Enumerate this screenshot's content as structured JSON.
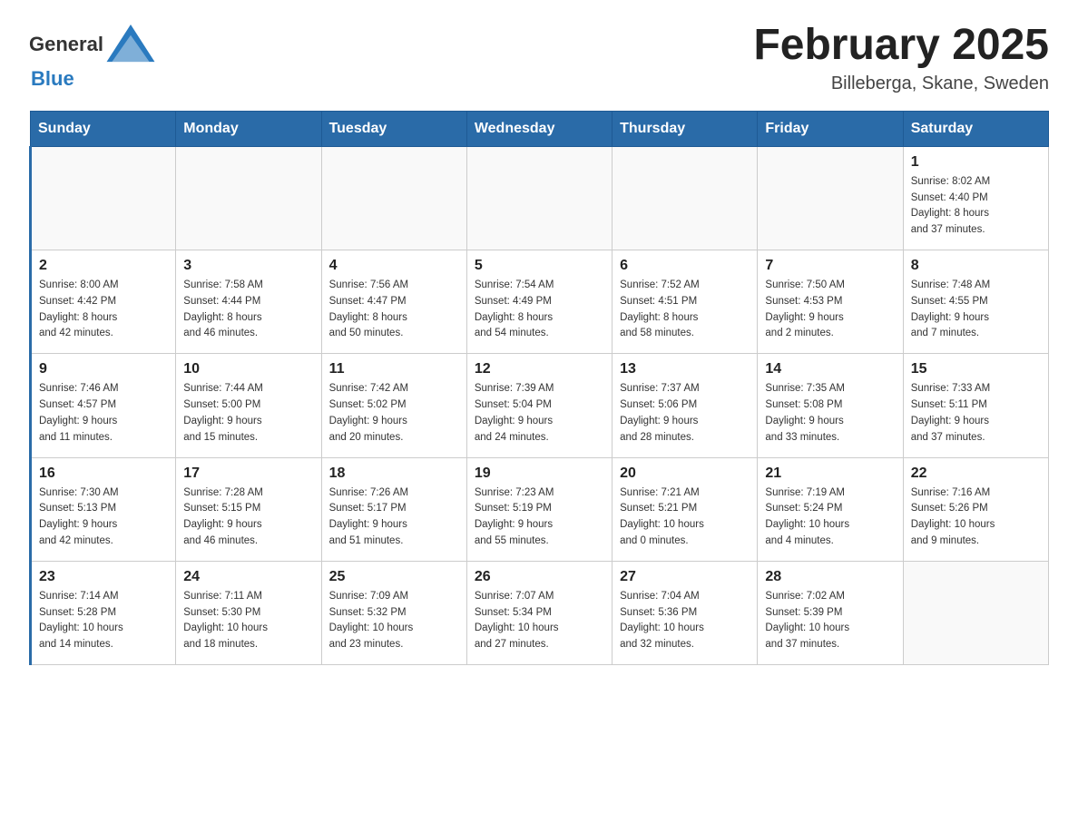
{
  "header": {
    "title": "February 2025",
    "subtitle": "Billeberga, Skane, Sweden",
    "logo_general": "General",
    "logo_blue": "Blue"
  },
  "weekdays": [
    "Sunday",
    "Monday",
    "Tuesday",
    "Wednesday",
    "Thursday",
    "Friday",
    "Saturday"
  ],
  "weeks": [
    {
      "days": [
        {
          "date": "",
          "info": ""
        },
        {
          "date": "",
          "info": ""
        },
        {
          "date": "",
          "info": ""
        },
        {
          "date": "",
          "info": ""
        },
        {
          "date": "",
          "info": ""
        },
        {
          "date": "",
          "info": ""
        },
        {
          "date": "1",
          "info": "Sunrise: 8:02 AM\nSunset: 4:40 PM\nDaylight: 8 hours\nand 37 minutes."
        }
      ]
    },
    {
      "days": [
        {
          "date": "2",
          "info": "Sunrise: 8:00 AM\nSunset: 4:42 PM\nDaylight: 8 hours\nand 42 minutes."
        },
        {
          "date": "3",
          "info": "Sunrise: 7:58 AM\nSunset: 4:44 PM\nDaylight: 8 hours\nand 46 minutes."
        },
        {
          "date": "4",
          "info": "Sunrise: 7:56 AM\nSunset: 4:47 PM\nDaylight: 8 hours\nand 50 minutes."
        },
        {
          "date": "5",
          "info": "Sunrise: 7:54 AM\nSunset: 4:49 PM\nDaylight: 8 hours\nand 54 minutes."
        },
        {
          "date": "6",
          "info": "Sunrise: 7:52 AM\nSunset: 4:51 PM\nDaylight: 8 hours\nand 58 minutes."
        },
        {
          "date": "7",
          "info": "Sunrise: 7:50 AM\nSunset: 4:53 PM\nDaylight: 9 hours\nand 2 minutes."
        },
        {
          "date": "8",
          "info": "Sunrise: 7:48 AM\nSunset: 4:55 PM\nDaylight: 9 hours\nand 7 minutes."
        }
      ]
    },
    {
      "days": [
        {
          "date": "9",
          "info": "Sunrise: 7:46 AM\nSunset: 4:57 PM\nDaylight: 9 hours\nand 11 minutes."
        },
        {
          "date": "10",
          "info": "Sunrise: 7:44 AM\nSunset: 5:00 PM\nDaylight: 9 hours\nand 15 minutes."
        },
        {
          "date": "11",
          "info": "Sunrise: 7:42 AM\nSunset: 5:02 PM\nDaylight: 9 hours\nand 20 minutes."
        },
        {
          "date": "12",
          "info": "Sunrise: 7:39 AM\nSunset: 5:04 PM\nDaylight: 9 hours\nand 24 minutes."
        },
        {
          "date": "13",
          "info": "Sunrise: 7:37 AM\nSunset: 5:06 PM\nDaylight: 9 hours\nand 28 minutes."
        },
        {
          "date": "14",
          "info": "Sunrise: 7:35 AM\nSunset: 5:08 PM\nDaylight: 9 hours\nand 33 minutes."
        },
        {
          "date": "15",
          "info": "Sunrise: 7:33 AM\nSunset: 5:11 PM\nDaylight: 9 hours\nand 37 minutes."
        }
      ]
    },
    {
      "days": [
        {
          "date": "16",
          "info": "Sunrise: 7:30 AM\nSunset: 5:13 PM\nDaylight: 9 hours\nand 42 minutes."
        },
        {
          "date": "17",
          "info": "Sunrise: 7:28 AM\nSunset: 5:15 PM\nDaylight: 9 hours\nand 46 minutes."
        },
        {
          "date": "18",
          "info": "Sunrise: 7:26 AM\nSunset: 5:17 PM\nDaylight: 9 hours\nand 51 minutes."
        },
        {
          "date": "19",
          "info": "Sunrise: 7:23 AM\nSunset: 5:19 PM\nDaylight: 9 hours\nand 55 minutes."
        },
        {
          "date": "20",
          "info": "Sunrise: 7:21 AM\nSunset: 5:21 PM\nDaylight: 10 hours\nand 0 minutes."
        },
        {
          "date": "21",
          "info": "Sunrise: 7:19 AM\nSunset: 5:24 PM\nDaylight: 10 hours\nand 4 minutes."
        },
        {
          "date": "22",
          "info": "Sunrise: 7:16 AM\nSunset: 5:26 PM\nDaylight: 10 hours\nand 9 minutes."
        }
      ]
    },
    {
      "days": [
        {
          "date": "23",
          "info": "Sunrise: 7:14 AM\nSunset: 5:28 PM\nDaylight: 10 hours\nand 14 minutes."
        },
        {
          "date": "24",
          "info": "Sunrise: 7:11 AM\nSunset: 5:30 PM\nDaylight: 10 hours\nand 18 minutes."
        },
        {
          "date": "25",
          "info": "Sunrise: 7:09 AM\nSunset: 5:32 PM\nDaylight: 10 hours\nand 23 minutes."
        },
        {
          "date": "26",
          "info": "Sunrise: 7:07 AM\nSunset: 5:34 PM\nDaylight: 10 hours\nand 27 minutes."
        },
        {
          "date": "27",
          "info": "Sunrise: 7:04 AM\nSunset: 5:36 PM\nDaylight: 10 hours\nand 32 minutes."
        },
        {
          "date": "28",
          "info": "Sunrise: 7:02 AM\nSunset: 5:39 PM\nDaylight: 10 hours\nand 37 minutes."
        },
        {
          "date": "",
          "info": ""
        }
      ]
    }
  ]
}
